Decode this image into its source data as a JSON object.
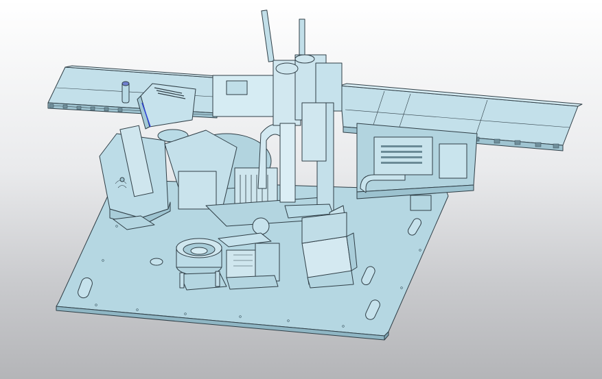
{
  "colors": {
    "background_top": "#ffffff",
    "background_bottom": "#b4b5b8",
    "part_fill": "#b9dbe6",
    "part_light": "#d4ebf2",
    "part_dark": "#8fb6c4",
    "edge": "#2e3d45",
    "highlight_edge": "#2b3fd8"
  },
  "model": {
    "parts": [
      "base-plate",
      "left-conveyor",
      "right-conveyor",
      "left-bracket",
      "upper-block",
      "rotary-table",
      "cylinder-column",
      "vibratory-bowl",
      "feeder-rail",
      "lower-housing",
      "right-feeder-track"
    ]
  }
}
